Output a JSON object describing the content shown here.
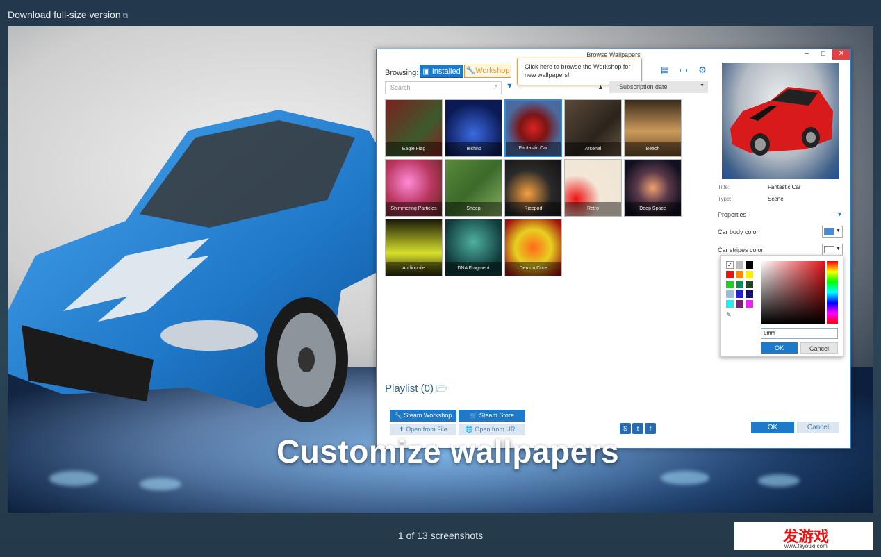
{
  "header": {
    "download_label": "Download full-size version"
  },
  "screenshot": {
    "tagline": "Customize wallpapers",
    "window": {
      "title": "Browse Wallpapers",
      "browsing_label": "Browsing:",
      "installed_label": "Installed",
      "workshop_label": "Workshop",
      "tooltip_text": "Click here to browse the Workshop for new wallpapers!",
      "search_placeholder": "Search",
      "sort_value": "Subscription date",
      "wallpapers": [
        {
          "label": "Eagle Flag"
        },
        {
          "label": "Techno"
        },
        {
          "label": "Fantastic Car"
        },
        {
          "label": "Arsenal"
        },
        {
          "label": "Beach"
        },
        {
          "label": "Shimmering Particles"
        },
        {
          "label": "Sheep"
        },
        {
          "label": "Ricepod"
        },
        {
          "label": "Retro"
        },
        {
          "label": "Deep Space"
        },
        {
          "label": "Audiophile"
        },
        {
          "label": "DNA Fragment"
        },
        {
          "label": "Demon Core"
        }
      ],
      "playlist_label": "Playlist (0)",
      "buttons": {
        "steam_workshop": "Steam Workshop",
        "steam_store": "Steam Store",
        "open_file": "Open from File",
        "open_url": "Open from URL",
        "ok": "OK",
        "cancel": "Cancel"
      },
      "details": {
        "title_label": "Title:",
        "title_value": "Fantastic Car",
        "type_label": "Type:",
        "type_value": "Scene",
        "properties_label": "Properties",
        "car_body_color_label": "Car body color",
        "car_stripes_color_label": "Car stripes color",
        "car_body_color": "#3d8de0",
        "car_stripes_color": "#ffffff"
      },
      "color_picker": {
        "hex_value": "#ffffff",
        "ok": "OK",
        "cancel": "Cancel"
      }
    }
  },
  "footer": {
    "counter": "1 of 13 screenshots"
  },
  "watermark": {
    "brand": "发游戏",
    "url": "www.fayouxi.com"
  }
}
